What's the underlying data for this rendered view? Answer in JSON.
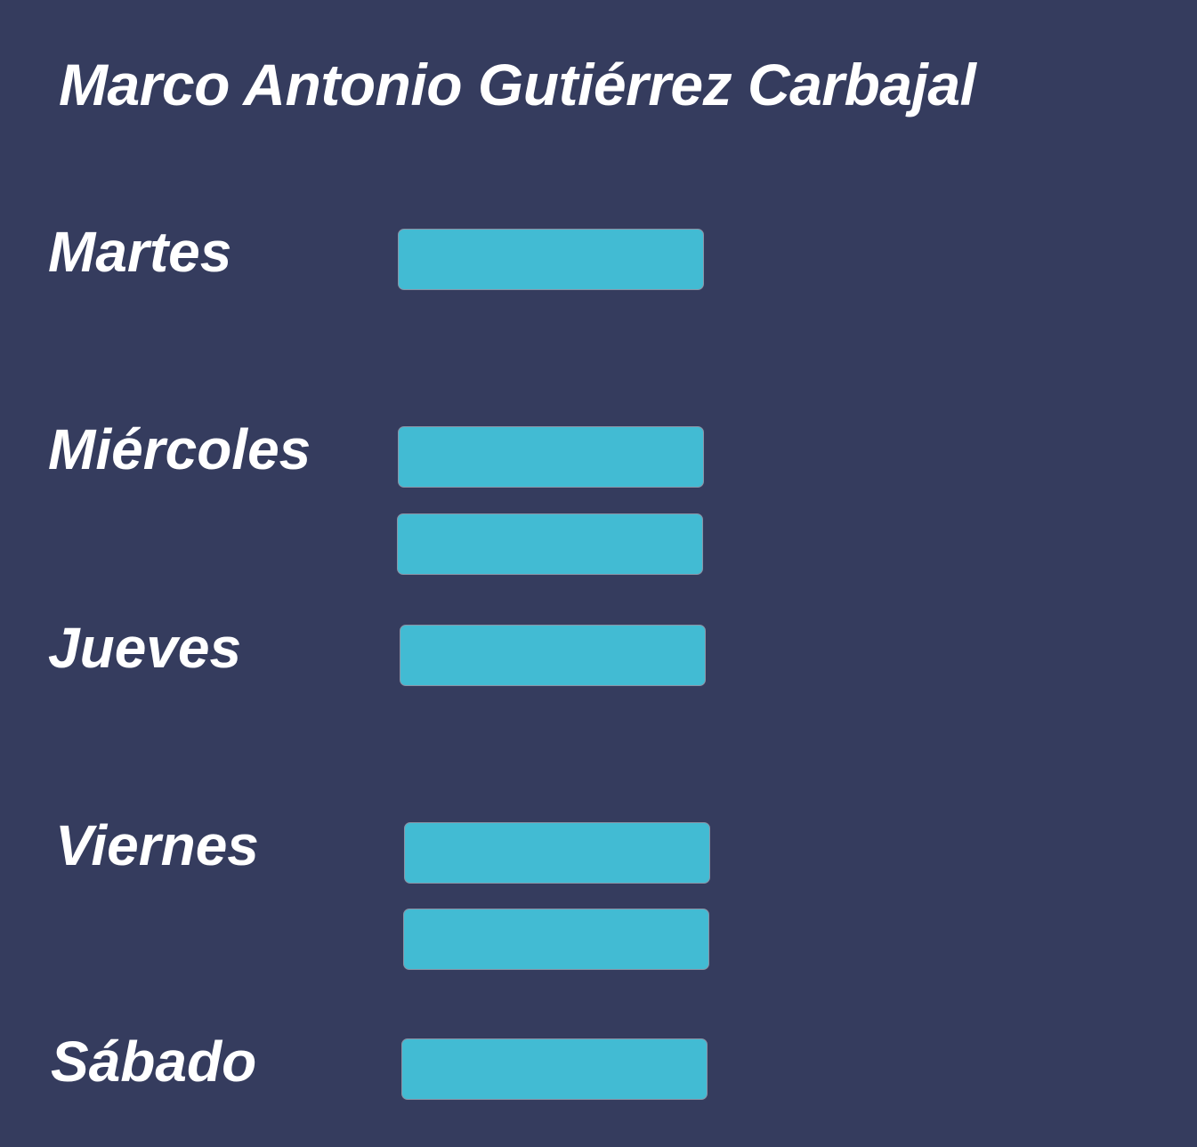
{
  "title": "Marco Antonio Gutiérrez Carbajal",
  "slot_color": "#42bbd3",
  "background_color": "#353c5e",
  "days": [
    {
      "label": "Martes",
      "slots": 1
    },
    {
      "label": "Miércoles",
      "slots": 2
    },
    {
      "label": "Jueves",
      "slots": 1
    },
    {
      "label": "Viernes",
      "slots": 2
    },
    {
      "label": "Sábado",
      "slots": 1
    }
  ]
}
